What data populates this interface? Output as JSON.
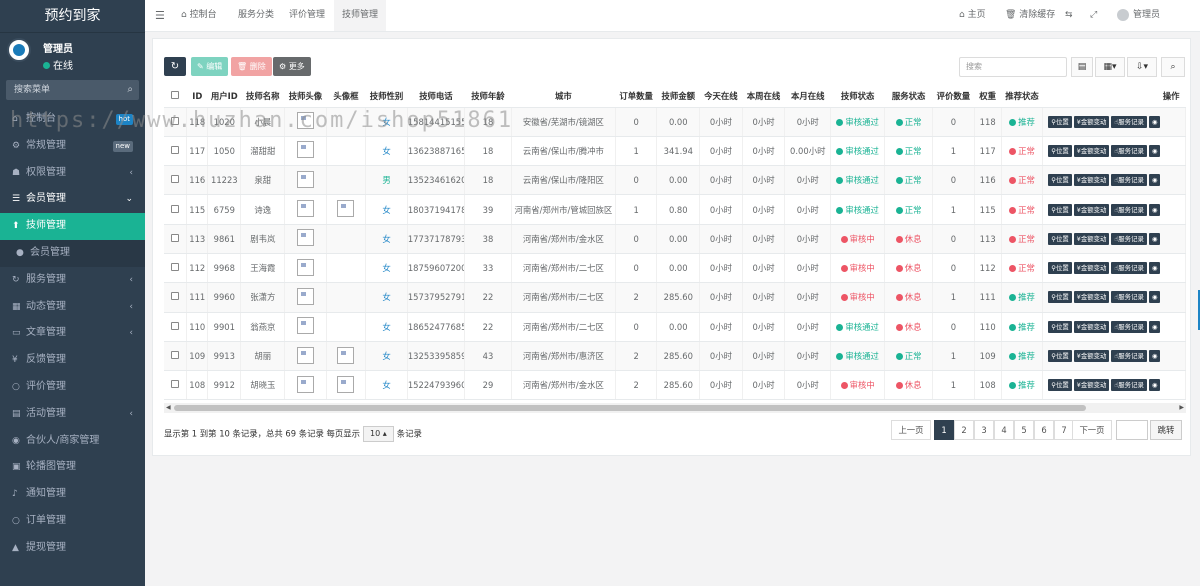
{
  "sidebar": {
    "brand": "预约到家",
    "user": {
      "name": "管理员",
      "status": "在线"
    },
    "search_placeholder": "搜索菜单",
    "items": [
      {
        "label": "控制台",
        "icon": "home-icon",
        "badge": "hot"
      },
      {
        "label": "常规管理",
        "icon": "gears-icon",
        "badge": "new"
      },
      {
        "label": "权限管理",
        "icon": "group-icon",
        "arrow": "‹"
      },
      {
        "label": "会员管理",
        "icon": "list-icon",
        "arrow": "⌄"
      },
      {
        "label": "技师管理",
        "icon": "pin-icon",
        "active": true
      },
      {
        "label": "会员管理",
        "icon": "user-icon",
        "sub": true
      },
      {
        "label": "服务管理",
        "icon": "refresh-icon",
        "arrow": "‹"
      },
      {
        "label": "动态管理",
        "icon": "calendar-icon",
        "arrow": "‹"
      },
      {
        "label": "文章管理",
        "icon": "file-icon",
        "arrow": "‹"
      },
      {
        "label": "反馈管理",
        "icon": "yen-icon"
      },
      {
        "label": "评价管理",
        "icon": "circle-icon"
      },
      {
        "label": "活动管理",
        "icon": "doc-icon",
        "arrow": "‹"
      },
      {
        "label": "合伙人/商家管理",
        "icon": "eye-icon"
      },
      {
        "label": "轮播图管理",
        "icon": "image-icon"
      },
      {
        "label": "通知管理",
        "icon": "bell-icon"
      },
      {
        "label": "订单管理",
        "icon": "circle-icon"
      },
      {
        "label": "提现管理",
        "icon": "caret-up-icon"
      }
    ]
  },
  "topbar": {
    "tabs": [
      "控制台",
      "服务分类",
      "评价管理",
      "技师管理"
    ],
    "active_tab": "技师管理",
    "home": "主页",
    "clear_cache": "清除缓存",
    "admin": "管理员"
  },
  "toolbar": {
    "edit": "编辑",
    "delete": "删除",
    "more": "更多",
    "search_placeholder": "搜索"
  },
  "table": {
    "columns": [
      "ID",
      "用户ID",
      "技师名称",
      "技师头像",
      "头像框",
      "技师性别",
      "技师电话",
      "技师年龄",
      "城市",
      "订单数量",
      "技师金额",
      "今天在线",
      "本周在线",
      "本月在线",
      "技师状态",
      "服务状态",
      "评价数量",
      "权重",
      "推荐状态",
      "操作"
    ],
    "actions": [
      "位置",
      "金额变动",
      "服务记录"
    ],
    "rows": [
      {
        "id": "118",
        "uid": "1020",
        "name": "小晨",
        "frame": false,
        "gender": "女",
        "phone": "15814415155",
        "age": "18",
        "city": "安徽省/芜湖市/镜湖区",
        "orders": "0",
        "amount": "0.00",
        "today": "0小时",
        "week": "0小时",
        "month": "0小时",
        "tstatus": "审核通过",
        "sstatus": "正常",
        "reviews": "0",
        "weight": "118",
        "rec": "推荐"
      },
      {
        "id": "117",
        "uid": "1050",
        "name": "溜甜甜",
        "frame": false,
        "gender": "女",
        "phone": "13623887165",
        "age": "18",
        "city": "云南省/保山市/腾冲市",
        "orders": "1",
        "amount": "341.94",
        "today": "0小时",
        "week": "0小时",
        "month": "0.00小时",
        "tstatus": "审核通过",
        "sstatus": "正常",
        "reviews": "1",
        "weight": "117",
        "rec": "正常"
      },
      {
        "id": "116",
        "uid": "11223",
        "name": "泉甜",
        "frame": false,
        "gender": "男",
        "phone": "13523461620",
        "age": "18",
        "city": "云南省/保山市/隆阳区",
        "orders": "0",
        "amount": "0.00",
        "today": "0小时",
        "week": "0小时",
        "month": "0小时",
        "tstatus": "审核通过",
        "sstatus": "正常",
        "reviews": "0",
        "weight": "116",
        "rec": "正常"
      },
      {
        "id": "115",
        "uid": "6759",
        "name": "诗逸",
        "frame": true,
        "gender": "女",
        "phone": "18037194178",
        "age": "39",
        "city": "河南省/郑州市/管城回族区",
        "orders": "1",
        "amount": "0.80",
        "today": "0小时",
        "week": "0小时",
        "month": "0小时",
        "tstatus": "审核通过",
        "sstatus": "正常",
        "reviews": "1",
        "weight": "115",
        "rec": "正常"
      },
      {
        "id": "113",
        "uid": "9861",
        "name": "剧韦岚",
        "frame": false,
        "gender": "女",
        "phone": "17737178793",
        "age": "38",
        "city": "河南省/郑州市/金水区",
        "orders": "0",
        "amount": "0.00",
        "today": "0小时",
        "week": "0小时",
        "month": "0小时",
        "tstatus": "审核中",
        "sstatus": "休息",
        "reviews": "0",
        "weight": "113",
        "rec": "正常"
      },
      {
        "id": "112",
        "uid": "9968",
        "name": "王海霞",
        "frame": false,
        "gender": "女",
        "phone": "18759607200",
        "age": "33",
        "city": "河南省/郑州市/二七区",
        "orders": "0",
        "amount": "0.00",
        "today": "0小时",
        "week": "0小时",
        "month": "0小时",
        "tstatus": "审核中",
        "sstatus": "休息",
        "reviews": "0",
        "weight": "112",
        "rec": "正常"
      },
      {
        "id": "111",
        "uid": "9960",
        "name": "张潇方",
        "frame": false,
        "gender": "女",
        "phone": "15737952791",
        "age": "22",
        "city": "河南省/郑州市/二七区",
        "orders": "2",
        "amount": "285.60",
        "today": "0小时",
        "week": "0小时",
        "month": "0小时",
        "tstatus": "审核中",
        "sstatus": "休息",
        "reviews": "1",
        "weight": "111",
        "rec": "推荐"
      },
      {
        "id": "110",
        "uid": "9901",
        "name": "翁燕京",
        "frame": false,
        "gender": "女",
        "phone": "18652477685",
        "age": "22",
        "city": "河南省/郑州市/二七区",
        "orders": "0",
        "amount": "0.00",
        "today": "0小时",
        "week": "0小时",
        "month": "0小时",
        "tstatus": "审核通过",
        "sstatus": "休息",
        "reviews": "0",
        "weight": "110",
        "rec": "推荐"
      },
      {
        "id": "109",
        "uid": "9913",
        "name": "胡丽",
        "frame": true,
        "gender": "女",
        "phone": "13253395859",
        "age": "43",
        "city": "河南省/郑州市/惠济区",
        "orders": "2",
        "amount": "285.60",
        "today": "0小时",
        "week": "0小时",
        "month": "0小时",
        "tstatus": "审核通过",
        "sstatus": "正常",
        "reviews": "1",
        "weight": "109",
        "rec": "推荐"
      },
      {
        "id": "108",
        "uid": "9912",
        "name": "胡晓玉",
        "frame": true,
        "gender": "女",
        "phone": "15224793960",
        "age": "29",
        "city": "河南省/郑州市/金水区",
        "orders": "2",
        "amount": "285.60",
        "today": "0小时",
        "week": "0小时",
        "month": "0小时",
        "tstatus": "审核中",
        "sstatus": "休息",
        "reviews": "1",
        "weight": "108",
        "rec": "推荐"
      }
    ]
  },
  "pagination": {
    "info_prefix": "显示第 1 到第 10 条记录，总共 69 条记录 每页显示",
    "page_size": "10",
    "info_suffix": "条记录",
    "prev": "上一页",
    "next": "下一页",
    "pages": [
      "1",
      "2",
      "3",
      "4",
      "5",
      "6",
      "7"
    ],
    "current": "1",
    "jump": "跳转"
  },
  "watermark": "https://www.huzhan.com/ishop51861",
  "colors": {
    "accent": "#1ab394",
    "sidebar": "#2f4050",
    "danger": "#ed5565",
    "info": "#1c84c6"
  }
}
